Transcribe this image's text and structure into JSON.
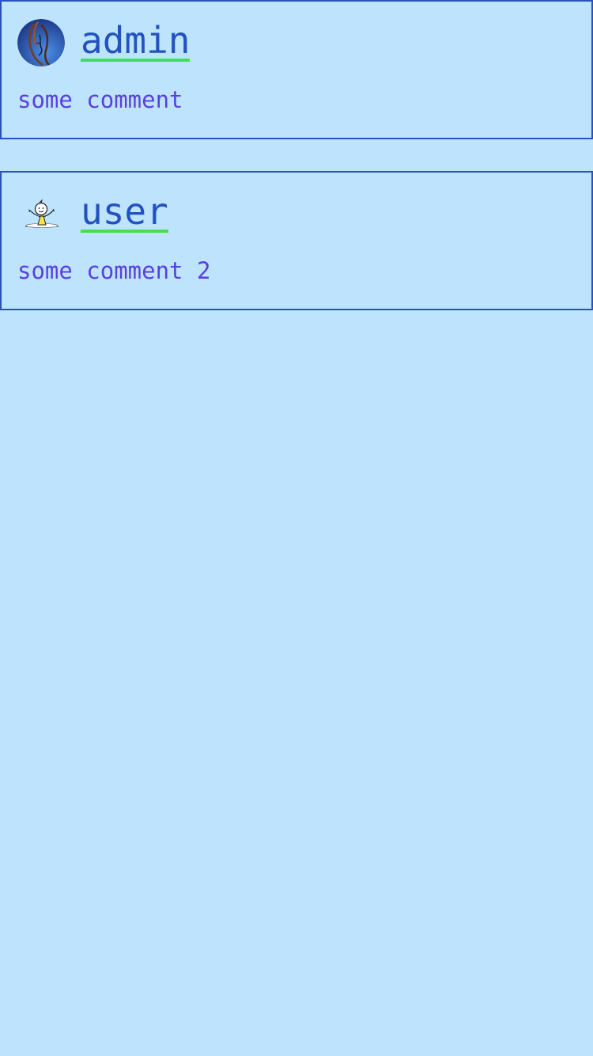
{
  "comments": [
    {
      "username": "admin",
      "text": "some comment",
      "avatar_icon": "woman-portrait-icon"
    },
    {
      "username": "user",
      "text": "some comment 2",
      "avatar_icon": "cartoon-person-icon"
    }
  ],
  "colors": {
    "background": "#bde4fc",
    "border": "#2a52be",
    "username": "#2252c0",
    "underline": "#44dd55",
    "comment_text": "#5a3fe0"
  }
}
